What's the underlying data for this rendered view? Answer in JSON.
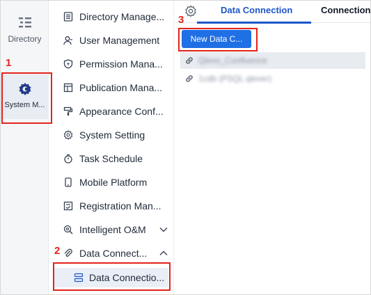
{
  "rail": {
    "items": [
      {
        "label": "Directory",
        "icon": "directory-list-icon"
      },
      {
        "label": "System M...",
        "icon": "system-gear-icon",
        "active": true
      }
    ]
  },
  "menu": {
    "items": [
      {
        "label": "Directory Manage...",
        "icon": "document-list-icon"
      },
      {
        "label": "User Management",
        "icon": "user-icon"
      },
      {
        "label": "Permission Mana...",
        "icon": "shield-icon"
      },
      {
        "label": "Publication Mana...",
        "icon": "layout-icon"
      },
      {
        "label": "Appearance Conf...",
        "icon": "paint-roller-icon"
      },
      {
        "label": "System Setting",
        "icon": "gear-icon"
      },
      {
        "label": "Task Schedule",
        "icon": "stopwatch-icon"
      },
      {
        "label": "Mobile Platform",
        "icon": "mobile-icon"
      },
      {
        "label": "Registration Man...",
        "icon": "registration-icon"
      },
      {
        "label": "Intelligent O&M",
        "icon": "search-gear-icon",
        "chevron": "down"
      },
      {
        "label": "Data Connect...",
        "icon": "paperclip-icon",
        "chevron": "up"
      }
    ],
    "sub_item": {
      "label": "Data Connectio...",
      "icon": "database-list-icon"
    }
  },
  "main": {
    "tabs": [
      {
        "label": "Data Connection",
        "active": true
      },
      {
        "label": "Connection",
        "active": false
      }
    ],
    "new_button": "New Data C...",
    "connections": [
      {
        "name": "Qlevo_Confluence",
        "selected": true
      },
      {
        "name": "1cdb (PSQL qlever)",
        "selected": false
      }
    ]
  },
  "annotations": [
    "1",
    "2",
    "3"
  ],
  "colors": {
    "accent": "#1e56c8",
    "button": "#1f6fe5",
    "annotation": "#e2231a",
    "rail_bg": "#f5f6f8",
    "selected_bg": "#e8ebf0"
  }
}
